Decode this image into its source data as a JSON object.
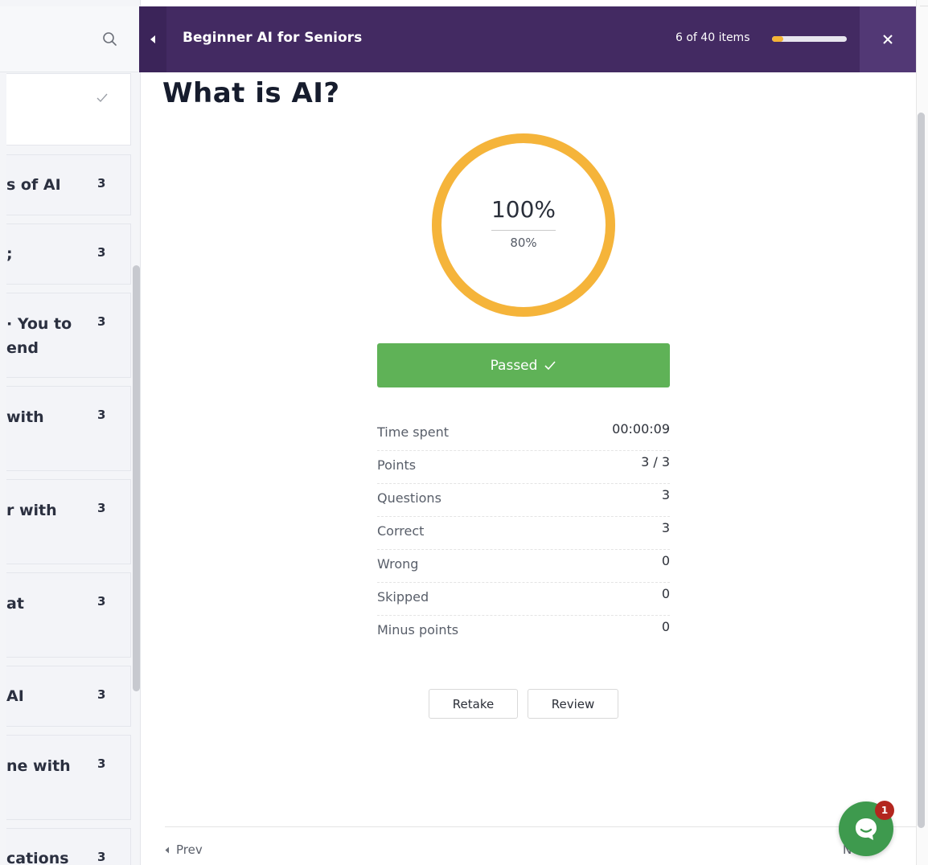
{
  "sidebar": {
    "items": [
      {
        "title": "",
        "count": "",
        "completed": true
      },
      {
        "title": "s of AI",
        "count": "3"
      },
      {
        "title": ";",
        "count": "3"
      },
      {
        "title": "· You to\nend",
        "count": "3"
      },
      {
        "title": " with",
        "count": "3"
      },
      {
        "title": "r with",
        "count": "3"
      },
      {
        "title": "at",
        "count": "3"
      },
      {
        "title": "AI",
        "count": "3"
      },
      {
        "title": "ne with",
        "count": "3"
      },
      {
        "title": "cations",
        "count": "3"
      }
    ]
  },
  "header": {
    "course_title": "Beginner AI for Seniors",
    "progress_text": "6 of 40 items",
    "progress_fraction": 0.15
  },
  "lesson": {
    "title": "What is AI?"
  },
  "result": {
    "score": "100%",
    "passing": "80%",
    "score_fraction": 1.0,
    "status_label": "Passed",
    "ring_color": "#f5b43a"
  },
  "stats": [
    {
      "label": "Time spent",
      "value": "00:00:09"
    },
    {
      "label": "Points",
      "value": "3 / 3"
    },
    {
      "label": "Questions",
      "value": "3"
    },
    {
      "label": "Correct",
      "value": "3"
    },
    {
      "label": "Wrong",
      "value": "0"
    },
    {
      "label": "Skipped",
      "value": "0"
    },
    {
      "label": "Minus points",
      "value": "0"
    }
  ],
  "actions": {
    "retake": "Retake",
    "review": "Review"
  },
  "nav": {
    "prev": "Prev",
    "next": "Next"
  },
  "chat": {
    "badge": "1"
  },
  "colors": {
    "header_bg": "#432a62",
    "passed_bg": "#5fb257",
    "progress_fill": "#f5b435"
  }
}
